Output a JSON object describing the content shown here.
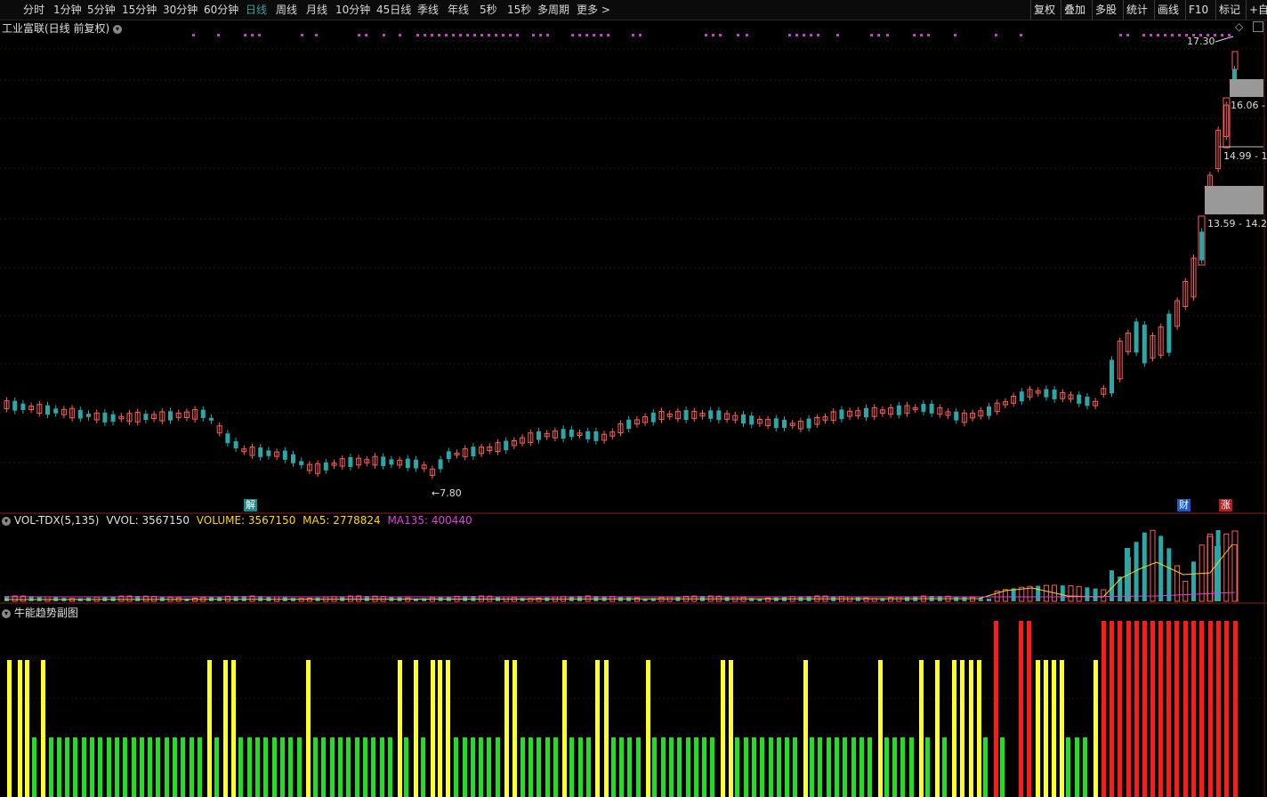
{
  "toolbar": {
    "periods": [
      "分时",
      "1分钟",
      "5分钟",
      "15分钟",
      "30分钟",
      "60分钟",
      "日线",
      "周线",
      "月线",
      "10分钟",
      "45日线",
      "季线",
      "年线",
      "5秒",
      "15秒",
      "多周期",
      "更多 >"
    ],
    "active_period": "日线",
    "right_buttons": [
      "复权",
      "叠加",
      "多股",
      "统计",
      "画线",
      "F10",
      "标记",
      "+自选"
    ]
  },
  "main_chart": {
    "title": "工业富联(日线 前复权)",
    "high_label": "17.30",
    "low_label": "7.80",
    "zone_labels": [
      "16.06 -",
      "14.99 - 1",
      "13.59 - 14.2"
    ],
    "event_tags": [
      {
        "text": "解",
        "color": "#1a8a8a"
      },
      {
        "text": "财",
        "color": "#1a5ac8"
      },
      {
        "text": "涨",
        "color": "#b02020"
      }
    ],
    "colors": {
      "up": "#ff5a5a",
      "down": "#2aa8a8",
      "dots": "#c040c0"
    }
  },
  "volume_panel": {
    "label": "VOL-TDX(5,135)",
    "vvol": "VVOL: 3567150",
    "volume": "VOLUME: 3567150",
    "ma5": "MA5: 2778824",
    "ma135": "MA135: 400440",
    "colors": {
      "vvol": "#e0e0e0",
      "volume": "#ffd700",
      "ma5": "#ffd700",
      "ma135": "#e040e0"
    }
  },
  "indicator_panel": {
    "label": "牛能趋势副图",
    "colors": {
      "green": "#22dd22",
      "yellow": "#ffff22",
      "red": "#ff1a1a"
    }
  }
}
